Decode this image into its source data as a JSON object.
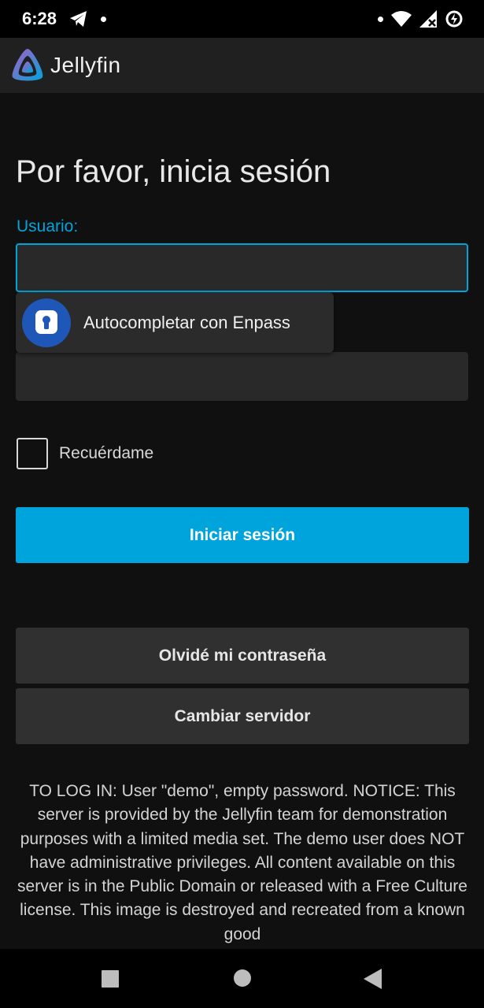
{
  "status_bar": {
    "time": "6:28",
    "icons": [
      "telegram-icon",
      "notification-dot-icon",
      "notification-dot-icon",
      "wifi-icon",
      "signal-no-data-icon",
      "battery-saver-icon"
    ]
  },
  "app_bar": {
    "title": "Jellyfin",
    "logo_icon": "jellyfin-logo-icon"
  },
  "login": {
    "heading": "Por favor, inicia sesión",
    "username_label": "Usuario:",
    "username_value": "",
    "password_value": "",
    "remember_label": "Recuérdame",
    "remember_checked": false,
    "login_button": "Iniciar sesión",
    "forgot_button": "Olvidé mi contraseña",
    "change_server_button": "Cambiar servidor"
  },
  "autofill": {
    "label": "Autocompletar con Enpass",
    "icon": "enpass-keyhole-icon"
  },
  "notice": "TO LOG IN: User \"demo\", empty password. NOTICE: This server is provided by the Jellyfin team for demonstration purposes with a limited media set. The demo user does NOT have administrative privileges. All content available on this server is in the Public Domain or released with a Free Culture license. This image is destroyed and recreated from a known good",
  "colors": {
    "accent": "#00a4dc",
    "background": "#101010",
    "app_bar": "#202020",
    "secondary_button": "#303030"
  },
  "nav_bar": {
    "icons": [
      "recents-square-icon",
      "home-circle-icon",
      "back-triangle-icon"
    ]
  }
}
